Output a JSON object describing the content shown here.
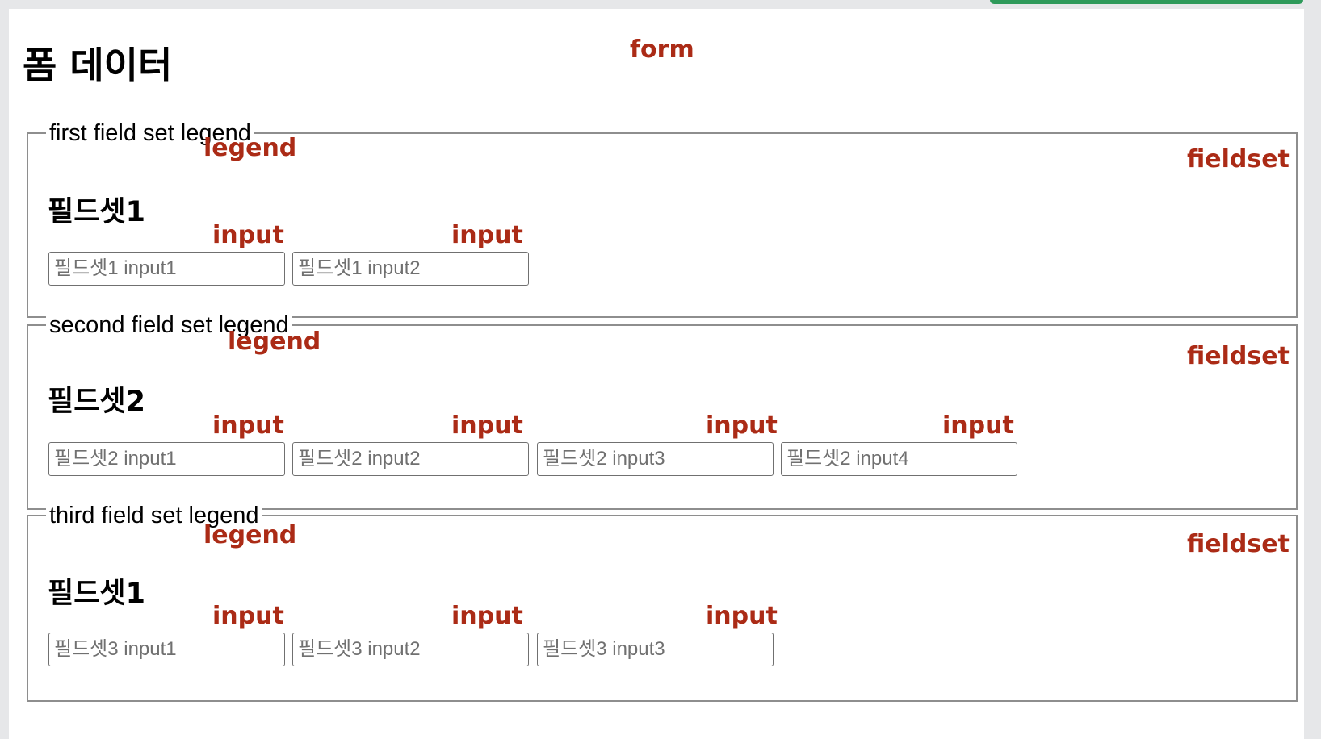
{
  "page": {
    "title": "폼 데이터",
    "form_annotation": "form"
  },
  "fieldsets": [
    {
      "legend": "first field set legend",
      "legend_annotation": "legend",
      "fieldset_annotation": "fieldset",
      "heading": "필드셋1",
      "input_annotations": [
        "input",
        "input"
      ],
      "inputs": [
        "필드셋1 input1",
        "필드셋1 input2"
      ]
    },
    {
      "legend": "second field set legend",
      "legend_annotation": "legend",
      "fieldset_annotation": "fieldset",
      "heading": "필드셋2",
      "input_annotations": [
        "input",
        "input",
        "input",
        "input"
      ],
      "inputs": [
        "필드셋2 input1",
        "필드셋2 input2",
        "필드셋2 input3",
        "필드셋2 input4"
      ]
    },
    {
      "legend": "third field set legend",
      "legend_annotation": "legend",
      "fieldset_annotation": "fieldset",
      "heading": "필드셋1",
      "input_annotations": [
        "input",
        "input",
        "input"
      ],
      "inputs": [
        "필드셋3 input1",
        "필드셋3 input2",
        "필드셋3 input3"
      ]
    }
  ],
  "colors": {
    "annotation": "#ab2b16",
    "fieldset_border": "#8e8e8e",
    "input_border": "#707070",
    "placeholder": "#707070",
    "top_accent": "#2e9a5a"
  }
}
